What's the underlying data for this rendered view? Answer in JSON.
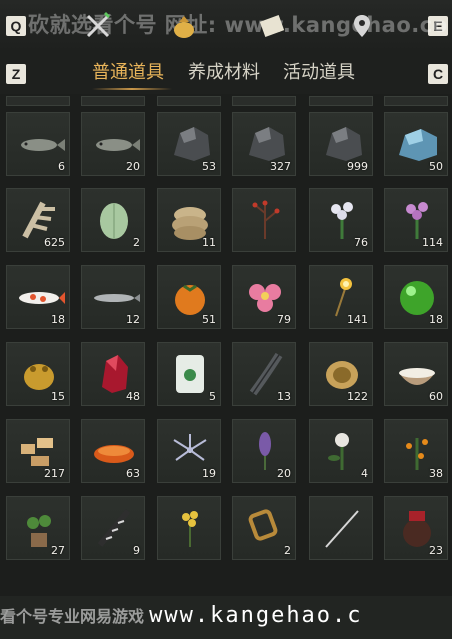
{
  "hotkeys": {
    "left_top": "Q",
    "right_top": "E",
    "left_tab": "Z",
    "right_tab": "C"
  },
  "watermark": {
    "top_text": "砍就选看个号 网址: www.kangehao.com",
    "bottom_text_cn": "看个号专业网易游戏",
    "bottom_url": "www.kangehao.c"
  },
  "top_icons": [
    "crossed-swords-icon",
    "money-bag-icon",
    "scroll-icon",
    "location-pin-icon"
  ],
  "tabs": [
    {
      "label": "普通道具",
      "active": true
    },
    {
      "label": "养成材料",
      "active": false
    },
    {
      "label": "活动道具",
      "active": false
    }
  ],
  "items": [
    {
      "row": 0,
      "col": 0,
      "icon": "fish-icon",
      "count": "6"
    },
    {
      "row": 0,
      "col": 1,
      "icon": "fish-icon",
      "count": "20"
    },
    {
      "row": 0,
      "col": 2,
      "icon": "dark-ore-icon",
      "count": "53"
    },
    {
      "row": 0,
      "col": 3,
      "icon": "dark-ore-icon",
      "count": "327"
    },
    {
      "row": 0,
      "col": 4,
      "icon": "dark-ore-icon",
      "count": "999"
    },
    {
      "row": 0,
      "col": 5,
      "icon": "blue-ore-icon",
      "count": "50"
    },
    {
      "row": 1,
      "col": 0,
      "icon": "bone-icon",
      "count": "625"
    },
    {
      "row": 1,
      "col": 1,
      "icon": "melon-icon",
      "count": "2"
    },
    {
      "row": 1,
      "col": 2,
      "icon": "grain-sack-icon",
      "count": "11"
    },
    {
      "row": 1,
      "col": 3,
      "icon": "red-berry-branch-icon",
      "count": ""
    },
    {
      "row": 1,
      "col": 4,
      "icon": "white-flower-icon",
      "count": "76"
    },
    {
      "row": 1,
      "col": 5,
      "icon": "purple-flower-icon",
      "count": "114"
    },
    {
      "row": 2,
      "col": 0,
      "icon": "koi-fish-icon",
      "count": "18"
    },
    {
      "row": 2,
      "col": 1,
      "icon": "silver-fish-icon",
      "count": "12"
    },
    {
      "row": 2,
      "col": 2,
      "icon": "persimmon-icon",
      "count": "51"
    },
    {
      "row": 2,
      "col": 3,
      "icon": "pink-flower-icon",
      "count": "79"
    },
    {
      "row": 2,
      "col": 4,
      "icon": "sparkler-icon",
      "count": "141"
    },
    {
      "row": 2,
      "col": 5,
      "icon": "green-orb-icon",
      "count": "18"
    },
    {
      "row": 3,
      "col": 0,
      "icon": "gold-toad-icon",
      "count": "15"
    },
    {
      "row": 3,
      "col": 1,
      "icon": "red-crystal-icon",
      "count": "48"
    },
    {
      "row": 3,
      "col": 2,
      "icon": "jade-carving-icon",
      "count": "5"
    },
    {
      "row": 3,
      "col": 3,
      "icon": "dark-feather-icon",
      "count": "13"
    },
    {
      "row": 3,
      "col": 4,
      "icon": "gold-ornament-icon",
      "count": "122"
    },
    {
      "row": 3,
      "col": 5,
      "icon": "milk-bowl-icon",
      "count": "60"
    },
    {
      "row": 4,
      "col": 0,
      "icon": "root-pieces-icon",
      "count": "217"
    },
    {
      "row": 4,
      "col": 1,
      "icon": "orange-cake-icon",
      "count": "63"
    },
    {
      "row": 4,
      "col": 2,
      "icon": "spider-lily-icon",
      "count": "19"
    },
    {
      "row": 4,
      "col": 3,
      "icon": "lavender-icon",
      "count": "20"
    },
    {
      "row": 4,
      "col": 4,
      "icon": "white-bloom-plant-icon",
      "count": "4"
    },
    {
      "row": 4,
      "col": 5,
      "icon": "orange-fruit-plant-icon",
      "count": "38"
    },
    {
      "row": 5,
      "col": 0,
      "icon": "potted-herb-icon",
      "count": "27"
    },
    {
      "row": 5,
      "col": 1,
      "icon": "striped-feather-icon",
      "count": "9"
    },
    {
      "row": 5,
      "col": 2,
      "icon": "yellow-flower-icon",
      "count": ""
    },
    {
      "row": 5,
      "col": 3,
      "icon": "golden-wheel-icon",
      "count": "2"
    },
    {
      "row": 5,
      "col": 4,
      "icon": "needle-icon",
      "count": ""
    },
    {
      "row": 5,
      "col": 5,
      "icon": "wine-jar-icon",
      "count": "23"
    }
  ],
  "colors": {
    "accent": "#e8b45a",
    "panel": "#1c1e1c",
    "cell": "#2b2f2b"
  }
}
